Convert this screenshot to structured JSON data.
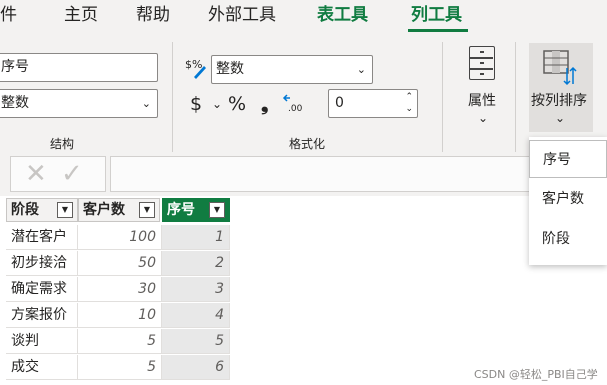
{
  "tabs": [
    {
      "label": "件",
      "active": false
    },
    {
      "label": "主页",
      "active": false
    },
    {
      "label": "帮助",
      "active": false
    },
    {
      "label": "外部工具",
      "active": false
    },
    {
      "label": "表工具",
      "active": false
    },
    {
      "label": "列工具",
      "active": true
    }
  ],
  "structure": {
    "name_value": "序号",
    "type_value": "整数",
    "group_label": "结构"
  },
  "formatting": {
    "format_value": "整数",
    "currency_symbol": "$",
    "percent_symbol": "%",
    "comma_symbol": "❟",
    "decimals_value": "0",
    "group_label": "格式化"
  },
  "properties": {
    "label": "属性"
  },
  "sort": {
    "label": "按列排序"
  },
  "sort_menu": {
    "items": [
      "序号",
      "客户数",
      "阶段"
    ]
  },
  "table": {
    "columns": [
      "阶段",
      "客户数",
      "序号"
    ],
    "rows": [
      [
        "潜在客户",
        "100",
        "1"
      ],
      [
        "初步接洽",
        "50",
        "2"
      ],
      [
        "确定需求",
        "30",
        "3"
      ],
      [
        "方案报价",
        "10",
        "4"
      ],
      [
        "谈判",
        "5",
        "5"
      ],
      [
        "成交",
        "5",
        "6"
      ]
    ]
  },
  "watermark": "CSDN @轻松_PBI自己学",
  "colors": {
    "accent": "#107c41",
    "ribbon_bg": "#f3f2f1"
  }
}
